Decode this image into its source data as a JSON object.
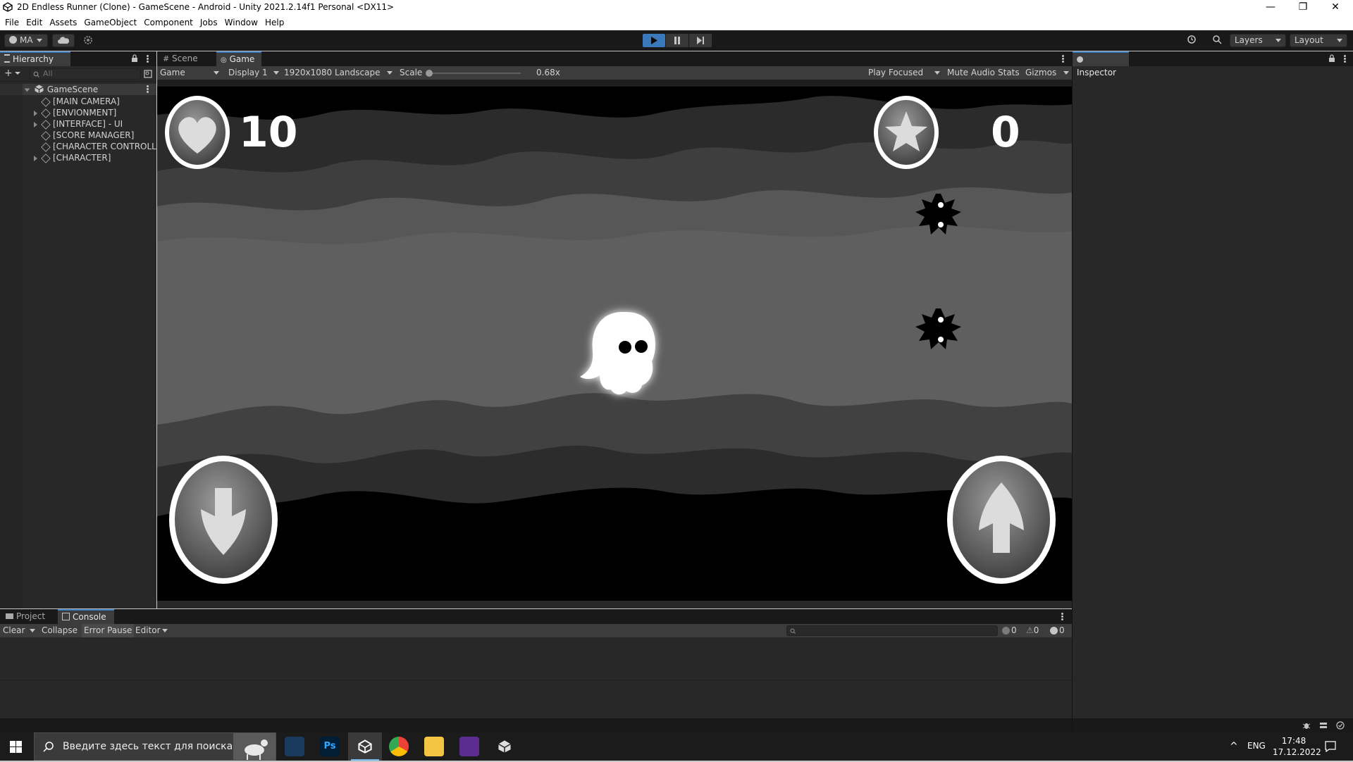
{
  "window": {
    "title": "2D Endless Runner (Clone) - GameScene - Android - Unity 2021.2.14f1 Personal <DX11>",
    "controls": [
      "—",
      "❐",
      "✕"
    ]
  },
  "menu": [
    "File",
    "Edit",
    "Assets",
    "GameObject",
    "Component",
    "Jobs",
    "Window",
    "Help"
  ],
  "toolbar": {
    "account": "MA",
    "layers": "Layers",
    "layout": "Layout"
  },
  "hierarchy": {
    "tab": "Hierarchy",
    "search_placeholder": "All",
    "scene": "GameScene",
    "items": [
      {
        "label": "[MAIN CAMERA]",
        "expandable": false
      },
      {
        "label": "[ENVIONMENT]",
        "expandable": true
      },
      {
        "label": "[INTERFACE] - UI",
        "expandable": true
      },
      {
        "label": "[SCORE MANAGER]",
        "expandable": false
      },
      {
        "label": "[CHARACTER CONTROLLER]",
        "expandable": false
      },
      {
        "label": "[CHARACTER]",
        "expandable": true
      }
    ]
  },
  "center_tabs": [
    "Scene",
    "Game"
  ],
  "game_view": {
    "mode": "Game",
    "display": "Display 1",
    "resolution": "1920x1080 Landscape",
    "scale_label": "Scale",
    "scale_value": "0.68x",
    "play_mode": "Play Focused",
    "mute": "Mute Audio",
    "stats": "Stats",
    "gizmos": "Gizmos"
  },
  "game": {
    "lives": "10",
    "score": "0"
  },
  "inspector": {
    "tab": "Inspector"
  },
  "bottom_tabs": [
    "Project",
    "Console"
  ],
  "console": {
    "clear": "Clear",
    "collapse": "Collapse",
    "error_pause": "Error Pause",
    "editor": "Editor",
    "log_count": "0",
    "warn_count": "0",
    "error_count": "0"
  },
  "taskbar": {
    "search_placeholder": "Введите здесь текст для поиска",
    "lang": "ENG",
    "time": "17:48",
    "date": "17.12.2022"
  }
}
